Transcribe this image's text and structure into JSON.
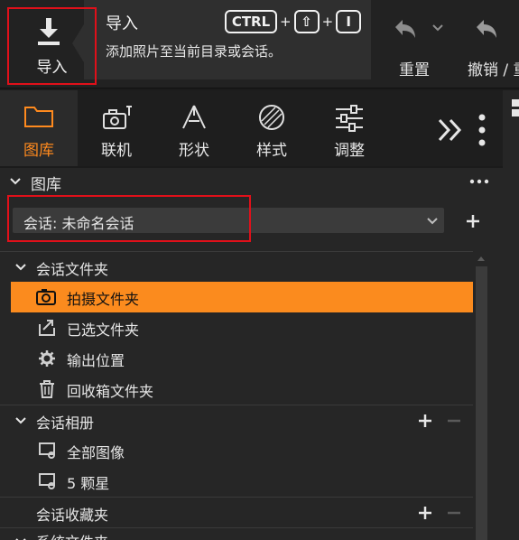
{
  "toolbar": {
    "import_label": "导入",
    "tooltip": {
      "title": "导入",
      "description": "添加照片至当前目录或会话。",
      "shortcut_keys": [
        "CTRL",
        "⇧",
        "I"
      ],
      "plus": "+"
    },
    "reset_label": "重置",
    "undo_label": "撤销 / 重做"
  },
  "tabs": [
    {
      "label": "图库",
      "icon": "folder-icon",
      "active": true
    },
    {
      "label": "联机",
      "icon": "camera-tether-icon",
      "active": false
    },
    {
      "label": "形状",
      "icon": "shape-icon",
      "active": false
    },
    {
      "label": "样式",
      "icon": "style-icon",
      "active": false
    },
    {
      "label": "调整",
      "icon": "sliders-icon",
      "active": false
    }
  ],
  "panel": {
    "title": "图库",
    "session_select": "会话: 未命名会话",
    "add_label": "+",
    "sections": {
      "session_folders": "会话文件夹",
      "session_albums": "会话相册",
      "session_favorites": "会话收藏夹",
      "system_folders": "系统文件夹"
    },
    "folders": [
      "拍摄文件夹",
      "已选文件夹",
      "输出位置",
      "回收箱文件夹"
    ],
    "albums": [
      "全部图像",
      "5 颗星"
    ]
  },
  "colors": {
    "accent": "#fb8b1e",
    "highlight_box": "#e0101a",
    "background": "#1b1b1b"
  }
}
